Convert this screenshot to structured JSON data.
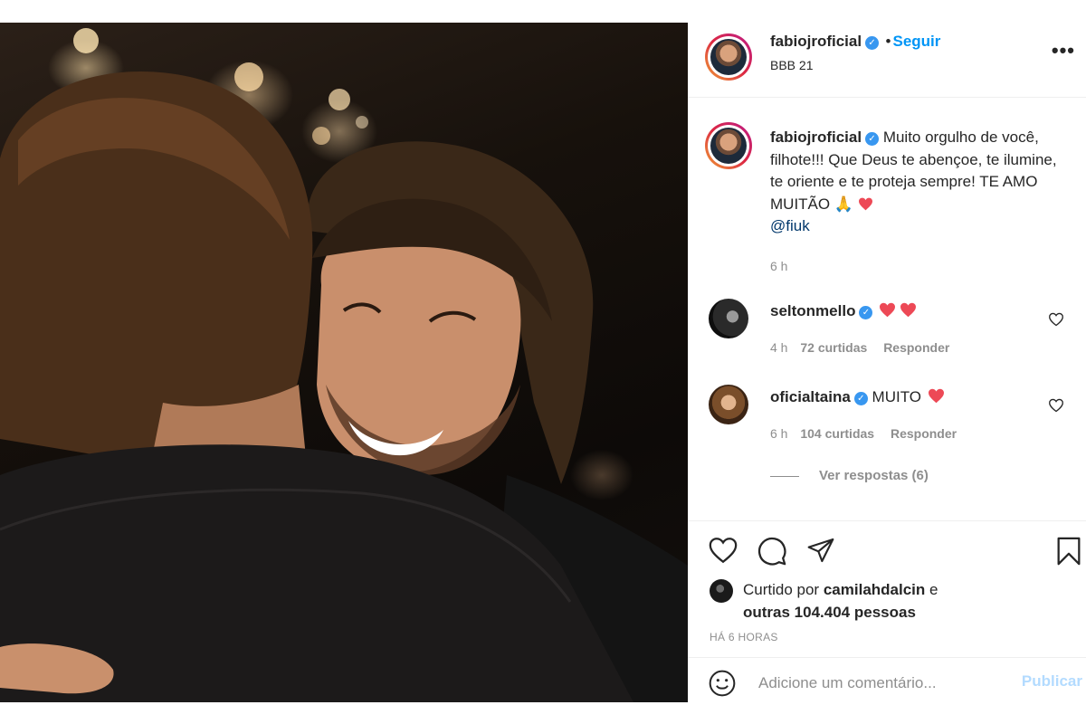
{
  "post": {
    "author": "fabiojroficial",
    "follow_separator": "•",
    "follow_label": "Seguir",
    "location": "BBB 21",
    "more_label": "•••"
  },
  "caption": {
    "author": "fabiojroficial",
    "text": "Muito orgulho de você, filhote!!! Que Deus te abençoe, te ilumine, te oriente e te proteja sempre! TE AMO MUITÃO 🙏",
    "mention": "@fiuk",
    "time": "6 h"
  },
  "comments": [
    {
      "user": "seltonmello",
      "text": "",
      "hearts": 2,
      "time": "4 h",
      "likes": "72 curtidas",
      "reply_label": "Responder"
    },
    {
      "user": "oficialtaina",
      "text": "MUITO",
      "hearts": 1,
      "time": "6 h",
      "likes": "104 curtidas",
      "reply_label": "Responder"
    }
  ],
  "view_replies": "Ver respostas (6)",
  "likes": {
    "prefix": "Curtido por",
    "user": "camilahdalcin",
    "conjunction": "e",
    "others": "outras 104.404 pessoas"
  },
  "timestamp": "Há 6 horas",
  "comment_box": {
    "placeholder": "Adicione um comentário...",
    "publish_label": "Publicar"
  },
  "colors": {
    "accent": "#0095f6",
    "heart": "#ed4956",
    "verified": "#3897f0",
    "muted": "#8e8e8e"
  },
  "icons": [
    "verified-icon",
    "more-options-icon",
    "heart-icon",
    "comment-icon",
    "share-icon",
    "bookmark-icon",
    "emoji-icon",
    "pray-emoji-icon"
  ]
}
